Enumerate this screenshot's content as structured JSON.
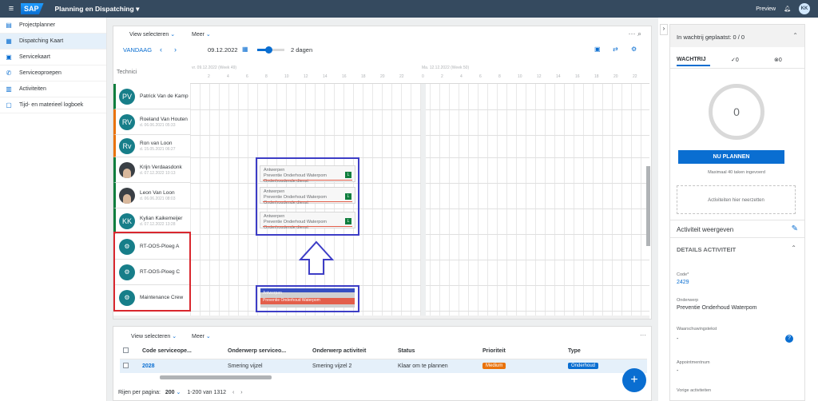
{
  "shell": {
    "title": "Planning en Dispatching",
    "preview": "Preview",
    "user_initials": "KK"
  },
  "sidebar": {
    "items": [
      {
        "label": "Projectplanner",
        "icon": "project-icon"
      },
      {
        "label": "Dispatching Kaart",
        "icon": "map-icon"
      },
      {
        "label": "Servicekaart",
        "icon": "card-icon"
      },
      {
        "label": "Serviceoproepen",
        "icon": "phone-icon"
      },
      {
        "label": "Activiteiten",
        "icon": "calendar-icon"
      },
      {
        "label": "Tijd- en materieel logboek",
        "icon": "clipboard-icon"
      }
    ]
  },
  "planner": {
    "view_select": "View selecteren",
    "more": "Meer",
    "today": "VANDAAG",
    "date": "09.12.2022",
    "range": "2 dagen",
    "technician_header": "Technici",
    "day1": "vr. 09.12.2022 (Week 49)",
    "day2": "Ma. 12.12.2022 (Week 50)",
    "hours1": [
      "2",
      "4",
      "6",
      "8",
      "10",
      "12",
      "14",
      "16",
      "18",
      "20",
      "22"
    ],
    "hours2": [
      "0",
      "2",
      "4",
      "6",
      "8",
      "10",
      "12",
      "14",
      "16",
      "18",
      "20",
      "22"
    ],
    "technicians": [
      {
        "initials": "PV",
        "name": "Patrick Van de Kamp",
        "sub": "",
        "color": "#107e3e"
      },
      {
        "initials": "RV",
        "name": "Roeland Van Houten",
        "sub": "d. 06.06.2021 05:33",
        "color": "#e9730c"
      },
      {
        "initials": "Rv",
        "name": "Ron van Loon",
        "sub": "d. 15.05.2021 06:27",
        "color": "#e9730c"
      },
      {
        "initials": "",
        "name": "Krijn Verdaasdonk",
        "sub": "d. 07.12.2022 10:13",
        "color": "#107e3e"
      },
      {
        "initials": "",
        "name": "Leon Van Loon",
        "sub": "d. 06.06.2021 08:03",
        "color": "#107e3e"
      },
      {
        "initials": "KK",
        "name": "Kylian Kaikemeijer",
        "sub": "d. 07.12.2022 13:28",
        "color": "#107e3e"
      },
      {
        "initials": "",
        "name": "RT-OOS-Ploeg A",
        "sub": "",
        "color": "#ffffff"
      },
      {
        "initials": "",
        "name": "RT-OOS-Ploeg C",
        "sub": "",
        "color": "#ffffff"
      },
      {
        "initials": "",
        "name": "Maintenance Crew",
        "sub": "",
        "color": "#ffffff"
      }
    ],
    "activities": [
      {
        "l1": "Antwerpen",
        "l2": "Preventie Onderhoud Waterpom",
        "l3": "Onderhoudende dienst",
        "tag": "L"
      },
      {
        "l1": "Antwerpen",
        "l2": "Preventie Onderhoud Waterpom",
        "l3": "Onderhoudende dienst",
        "tag": "L"
      },
      {
        "l1": "Antwerpen",
        "l2": "Preventie Onderhoud Waterpom",
        "l3": "Onderhoudende dienst",
        "tag": "L"
      }
    ],
    "new_activity": {
      "l1": "Antwerpen",
      "l2": "Preventie Onderhoud Waterpom"
    }
  },
  "table": {
    "view_select": "View selecteren",
    "more": "Meer",
    "columns": [
      "Code serviceope...",
      "Onderwerp serviceo...",
      "Onderwerp activiteit",
      "Status",
      "Prioriteit",
      "Type"
    ],
    "rows": [
      {
        "code": "2028",
        "subject": "Smering vijzel",
        "activity": "Smering vijzel 2",
        "status": "Klaar om te plannen",
        "priority": "Medium",
        "type": "Onderhoud"
      }
    ],
    "rows_per_page_label": "Rijen per pagina:",
    "rows_per_page": "200",
    "range": "1-200 van",
    "total": "1312"
  },
  "queue": {
    "title": "In wachtrij geplaatst: 0 / 0",
    "tab_queue": "WACHTRIJ",
    "tab_ok": "0",
    "tab_x": "0",
    "count": "0",
    "plan_button": "NU PLANNEN",
    "max_note": "Maximaal 40 taken ingevoerd",
    "drop_hint": "Activiteiten hier neerzetten",
    "show_activity": "Activiteit weergeven",
    "details_title": "DETAILS ACTIVITEIT",
    "code_label": "Code*",
    "code_value": "2429",
    "subject_label": "Onderwerp",
    "subject_value": "Preventie Onderhoud Waterpom",
    "warn_label": "Waarschuwingstekst",
    "warn_value": "-",
    "appt_label": "Appointmentnum",
    "appt_value": "-",
    "prev_label": "Vorige activiteiten"
  },
  "colors": {
    "shell": "#354a5f",
    "accent": "#0a6ed1",
    "annotation_red": "#d9272e",
    "annotation_blue": "#3d3dc6"
  }
}
